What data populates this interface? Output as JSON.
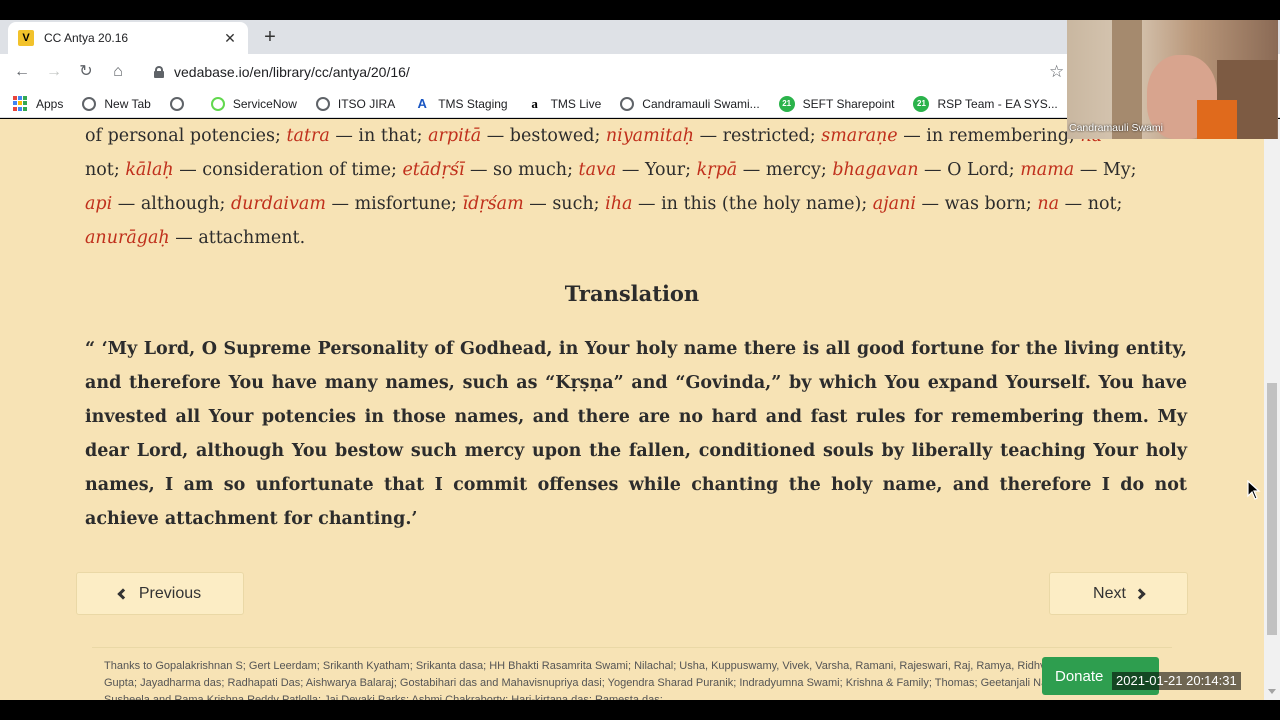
{
  "browser": {
    "tab_title": "CC Antya 20.16",
    "tab_favicon_letter": "V",
    "url": "vedabase.io/en/library/cc/antya/20/16/",
    "bookmarks": [
      {
        "label": "Apps",
        "icon": "apps-icon"
      },
      {
        "label": "New Tab",
        "icon": "globe-icon"
      },
      {
        "label": "",
        "icon": "globe-icon"
      },
      {
        "label": "ServiceNow",
        "icon": "servicenow-icon"
      },
      {
        "label": "ITSO JIRA",
        "icon": "globe-icon"
      },
      {
        "label": "TMS Staging",
        "icon": "tms-icon"
      },
      {
        "label": "TMS Live",
        "icon": "amazon-icon"
      },
      {
        "label": "Candramauli Swami...",
        "icon": "globe-icon"
      },
      {
        "label": "SEFT Sharepoint",
        "icon": "sharepoint-icon"
      },
      {
        "label": "RSP Team - EA SYS...",
        "icon": "sharepoint-icon"
      }
    ]
  },
  "page": {
    "synonym_lines": [
      [
        {
          "t": "of personal potencies; "
        },
        {
          "w": "tatra"
        },
        {
          "t": " — in that; "
        },
        {
          "w": "arpitā"
        },
        {
          "t": " — bestowed; "
        },
        {
          "w": "niyamitaḥ"
        },
        {
          "t": " — restricted; "
        },
        {
          "w": "smaraṇe"
        },
        {
          "t": " — in remembering; "
        },
        {
          "w": "na"
        }
      ],
      [
        {
          "t": "not; "
        },
        {
          "w": "kālaḥ"
        },
        {
          "t": " — consideration of time; "
        },
        {
          "w": "etādṛśī"
        },
        {
          "t": " — so much; "
        },
        {
          "w": "tava"
        },
        {
          "t": " — Your; "
        },
        {
          "w": "kṛpā"
        },
        {
          "t": " — mercy; "
        },
        {
          "w": "bhagavan"
        },
        {
          "t": " — O Lord; "
        },
        {
          "w": "mama"
        },
        {
          "t": " — My;"
        }
      ],
      [
        {
          "w": "api"
        },
        {
          "t": " — although; "
        },
        {
          "w": "durdaivam"
        },
        {
          "t": " — misfortune; "
        },
        {
          "w": "īdṛśam"
        },
        {
          "t": " — such; "
        },
        {
          "w": "iha"
        },
        {
          "t": " — in this (the holy name); "
        },
        {
          "w": "ajani"
        },
        {
          "t": " — was born; "
        },
        {
          "w": "na"
        },
        {
          "t": " — not;"
        }
      ],
      [
        {
          "w": "anurāgaḥ"
        },
        {
          "t": " — attachment."
        }
      ]
    ],
    "translation_heading": "Translation",
    "translation_text": "“ ‘My Lord, O Supreme Personality of Godhead, in Your holy name there is all good fortune for the living entity, and therefore You have many names, such as “Kṛṣṇa” and “Govinda,” by which You expand Yourself. You have invested all Your potencies in those names, and there are no hard and fast rules for remembering them. My dear Lord, although You bestow such mercy upon the fallen, conditioned souls by liberally teaching Your holy names, I am so unfortunate that I commit offenses while chanting the holy name, and therefore I do not achieve attachment for chanting.’",
    "prev_label": "Previous",
    "next_label": "Next",
    "thanks_text": "Thanks to Gopalakrishnan S; Gert Leerdam; Srikanth Kyatham; Srikanta dasa; HH Bhakti Rasamrita Swami; Nilachal; Usha, Kuppuswamy, Vivek, Varsha, Ramani, Rajeswari, Raj, Ramya, Ridhvik, Radha; Bimal Gupta; Jayadharma das; Radhapati Das; Aishwarya Balaraj; Gostabihari das and Mahavisnupriya dasi; Yogendra Sharad Puranik; Indradyumna Swami; Krishna & Family; Thomas; Geetanjali Nath; Mario; Jasie; Susheela and Rama Krishna Reddy Patlolla; Jai Devaki Parks; Ashmi Chakraborty; Hari-kirtana das; Ramesta das;",
    "donate_label": "Donate"
  },
  "overlay": {
    "camera_name": "Candramauli Swami",
    "timestamp": "2021-01-21  20:14:31"
  },
  "colors": {
    "page_bg": "#f7e3b5",
    "sanskrit_word": "#c0301c",
    "donate_bg": "#2e9e4f"
  }
}
